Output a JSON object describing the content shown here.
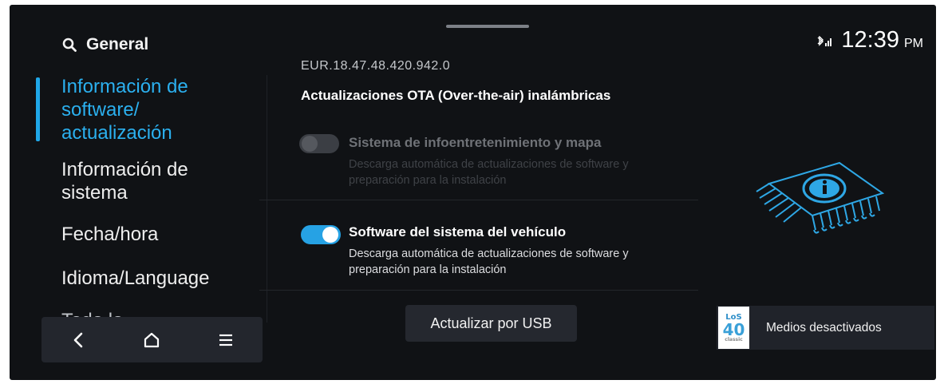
{
  "colors": {
    "accent": "#1fa7e8",
    "screen_bg": "#101215",
    "panel_bg": "#23262d"
  },
  "sidebar": {
    "search_icon": "search-icon",
    "search_label": "General",
    "items": [
      {
        "lines": [
          "Información de",
          "software/",
          "actualización"
        ],
        "active": true
      },
      {
        "lines": [
          "Información de",
          "sistema"
        ],
        "active": false
      },
      {
        "lines": [
          "Fecha/hora"
        ],
        "active": false
      },
      {
        "lines": [
          "Idioma/Language"
        ],
        "active": false
      }
    ],
    "partial_item": "Todo lo"
  },
  "bottom_nav": {
    "icons": [
      "back-icon",
      "home-icon",
      "menu-icon"
    ]
  },
  "main": {
    "version": "EUR.18.47.48.420.942.0",
    "section_title": "Actualizaciones OTA (Over-the-air) inalámbricas",
    "options": [
      {
        "title": "Sistema de infoentretenimiento y mapa",
        "desc_1": "Descarga automática de actualizaciones de software y",
        "desc_2": "preparación para la instalación",
        "enabled": false,
        "toggle_on": false
      },
      {
        "title": "Software del sistema del vehículo",
        "desc_1": "Descarga automática de actualizaciones de software y",
        "desc_2": "preparación para la instalación",
        "enabled": true,
        "toggle_on": true
      }
    ],
    "usb_button": "Actualizar por USB"
  },
  "status": {
    "signal_icon": "bluetooth-signal-icon",
    "time": "12:39",
    "ampm": "PM"
  },
  "illustration": {
    "icon": "chip-info-icon"
  },
  "media": {
    "logo_line1": "LoS",
    "logo_line2": "40",
    "logo_line3": "classic",
    "label": "Medios desactivados"
  }
}
